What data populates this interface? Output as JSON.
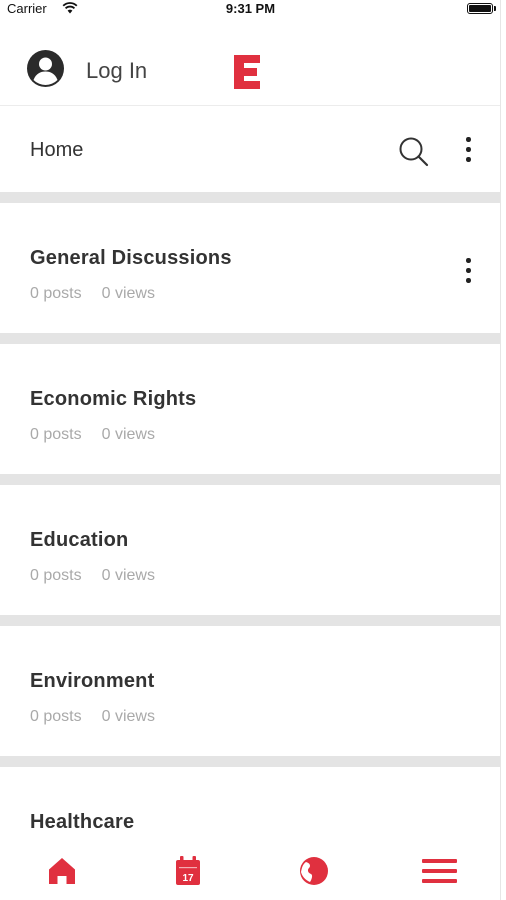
{
  "status_bar": {
    "carrier": "Carrier",
    "time": "9:31 PM"
  },
  "header": {
    "login_label": "Log In",
    "logo_letter": "E"
  },
  "sub_header": {
    "title": "Home"
  },
  "forums": [
    {
      "title": "General Discussions",
      "posts": "0 posts",
      "views": "0 views",
      "has_menu": true
    },
    {
      "title": "Economic Rights",
      "posts": "0 posts",
      "views": "0 views",
      "has_menu": false
    },
    {
      "title": "Education",
      "posts": "0 posts",
      "views": "0 views",
      "has_menu": false
    },
    {
      "title": "Environment",
      "posts": "0 posts",
      "views": "0 views",
      "has_menu": false
    },
    {
      "title": "Healthcare",
      "posts": "",
      "views": "",
      "has_menu": false
    }
  ],
  "tab_bar": {
    "calendar_day": "17",
    "tabs": [
      "home-icon",
      "calendar-icon",
      "globe-icon",
      "menu-icon"
    ]
  },
  "colors": {
    "accent": "#e0303f",
    "divider": "#e4e4e4",
    "meta_text": "#a9a9a9"
  }
}
